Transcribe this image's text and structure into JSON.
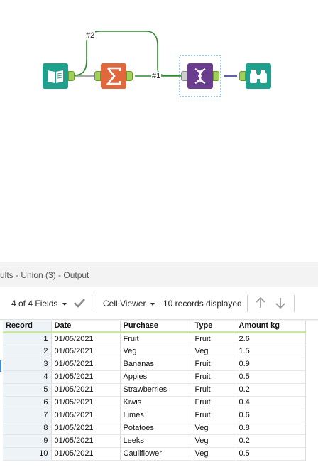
{
  "workflow": {
    "wire_labels": [
      "#2",
      "#1"
    ],
    "tools": [
      {
        "name": "Input Data",
        "icon": "book-icon",
        "color": "#1fa08c"
      },
      {
        "name": "Summarize",
        "icon": "sigma-icon",
        "color": "#e1673c"
      },
      {
        "name": "Union",
        "icon": "dna-icon",
        "color": "#6a3d8f"
      },
      {
        "name": "Browse",
        "icon": "binoculars-icon",
        "color": "#1fa08c"
      }
    ],
    "wire_color": "#2e8b2e",
    "output_wire_color": "#2d2d9a"
  },
  "results": {
    "title": "ults - Union (3) - Output",
    "fields_label": "4 of 4 Fields",
    "viewer_label": "Cell Viewer",
    "records_label": "10 records displayed",
    "columns": [
      "Record",
      "Date",
      "Purchase",
      "Type",
      "Amount kg"
    ],
    "rows": [
      [
        "1",
        "01/05/2021",
        "Fruit",
        "Fruit",
        "2.6"
      ],
      [
        "2",
        "01/05/2021",
        "Veg",
        "Veg",
        "1.5"
      ],
      [
        "3",
        "01/05/2021",
        "Bananas",
        "Fruit",
        "0.9"
      ],
      [
        "4",
        "01/05/2021",
        "Apples",
        "Fruit",
        "0.5"
      ],
      [
        "5",
        "01/05/2021",
        "Strawberries",
        "Fruit",
        "0.2"
      ],
      [
        "6",
        "01/05/2021",
        "Kiwis",
        "Fruit",
        "0.4"
      ],
      [
        "7",
        "01/05/2021",
        "Limes",
        "Fruit",
        "0.6"
      ],
      [
        "8",
        "01/05/2021",
        "Potatoes",
        "Veg",
        "0.8"
      ],
      [
        "9",
        "01/05/2021",
        "Leeks",
        "Veg",
        "0.2"
      ],
      [
        "10",
        "01/05/2021",
        "Cauliflower",
        "Veg",
        "0.5"
      ]
    ]
  }
}
